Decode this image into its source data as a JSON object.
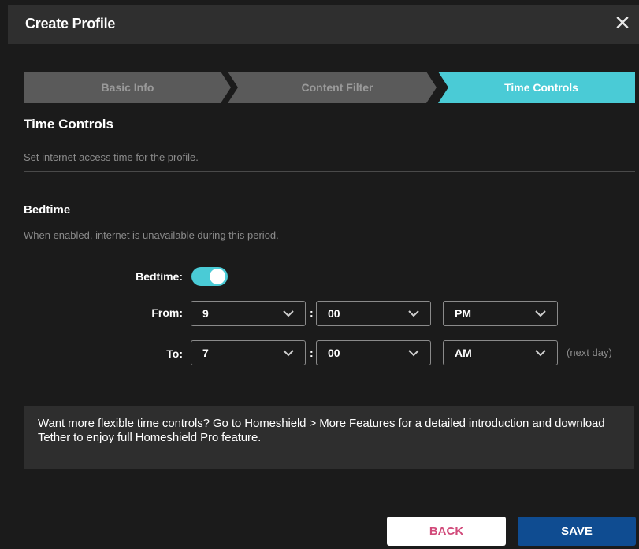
{
  "dialog": {
    "title": "Create Profile",
    "close_symbol": "✕"
  },
  "steps": [
    {
      "label": "Basic Info",
      "state": "completed"
    },
    {
      "label": "Content Filter",
      "state": "completed"
    },
    {
      "label": "Time Controls",
      "state": "active"
    }
  ],
  "section": {
    "title": "Time Controls",
    "description": "Set internet access time for the profile."
  },
  "bedtime": {
    "title": "Bedtime",
    "description": "When enabled, internet is unavailable during this period.",
    "toggle_label": "Bedtime:",
    "enabled": true,
    "from_label": "From:",
    "to_label": "To:",
    "from": {
      "hour": "9",
      "minute": "00",
      "ampm": "PM"
    },
    "to": {
      "hour": "7",
      "minute": "00",
      "ampm": "AM"
    },
    "colon": ":",
    "next_day_note": "(next day)"
  },
  "info_box": {
    "text": "Want more flexible time controls? Go to Homeshield > More Features for a detailed introduction and download Tether to enjoy full Homeshield Pro feature."
  },
  "buttons": {
    "back": "BACK",
    "save": "SAVE"
  },
  "colors": {
    "accent": "#4acbd6",
    "step_inactive": "#585858",
    "primary_button": "#0f4c91",
    "back_text": "#d14a7a"
  },
  "icons": {
    "close": "close-icon",
    "chevron": "chevron-down-icon"
  }
}
